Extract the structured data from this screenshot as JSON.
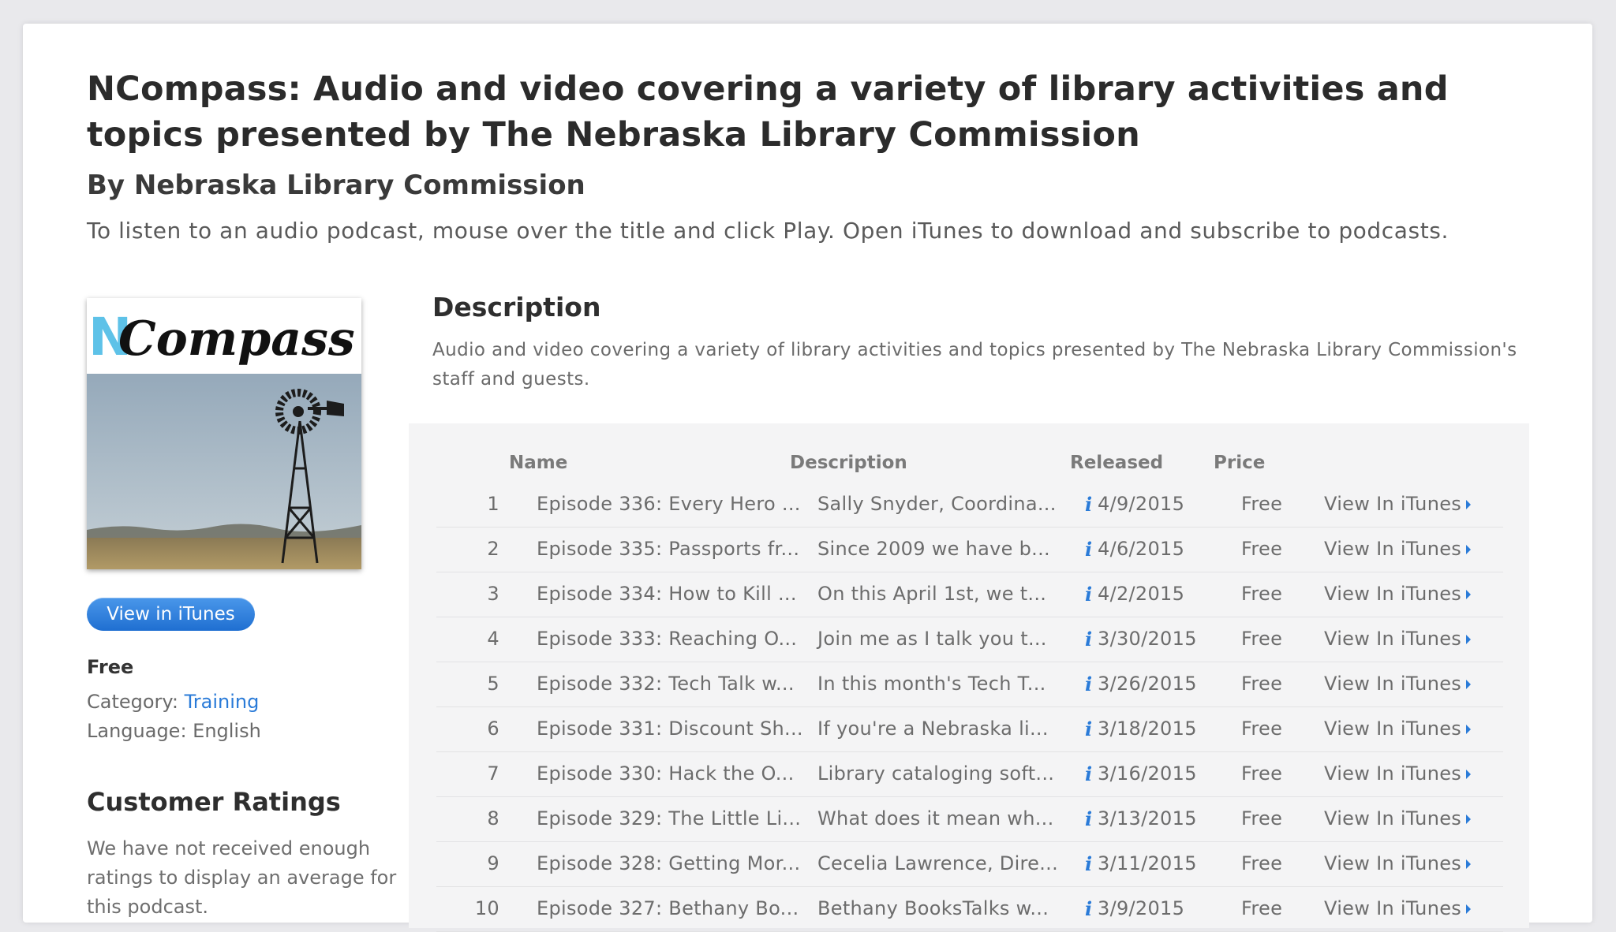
{
  "podcast": {
    "title": "NCompass: Audio and video covering a variety of library activities and topics presented by The Nebraska Library Commission",
    "byline": "By Nebraska Library Commission",
    "instructions": "To listen to an audio podcast, mouse over the title and click Play. Open iTunes to download and subscribe to podcasts.",
    "artwork_logo_text": "NCompass",
    "view_button_label": "View in iTunes",
    "price": "Free",
    "category_label": "Category: ",
    "category_value": "Training",
    "language_label": "Language: ",
    "language_value": "English"
  },
  "ratings": {
    "heading": "Customer Ratings",
    "text": "We have not received enough ratings to display an average for this podcast."
  },
  "description": {
    "heading": "Description",
    "text": "Audio and video covering a variety of library activities and topics presented by The Nebraska Library Commission's staff and guests."
  },
  "episodes": {
    "columns": {
      "name": "Name",
      "description": "Description",
      "released": "Released",
      "price": "Price"
    },
    "info_icon": "i",
    "link_label": "View In iTunes",
    "rows": [
      {
        "num": "1",
        "name": "Episode 336: Every Hero ...",
        "desc": "Sally Snyder, Coordina...",
        "date": "4/9/2015",
        "price": "Free"
      },
      {
        "num": "2",
        "name": "Episode 335: Passports fr...",
        "desc": "Since 2009 we have b...",
        "date": "4/6/2015",
        "price": "Free"
      },
      {
        "num": "3",
        "name": "Episode 334: How to Kill ...",
        "desc": "On this April 1st, we t...",
        "date": "4/2/2015",
        "price": "Free"
      },
      {
        "num": "4",
        "name": "Episode 333: Reaching O...",
        "desc": "Join me as I talk you t...",
        "date": "3/30/2015",
        "price": "Free"
      },
      {
        "num": "5",
        "name": "Episode 332: Tech Talk w...",
        "desc": "In this month's Tech T...",
        "date": "3/26/2015",
        "price": "Free"
      },
      {
        "num": "6",
        "name": "Episode 331: Discount Sh...",
        "desc": "If you're a Nebraska li...",
        "date": "3/18/2015",
        "price": "Free"
      },
      {
        "num": "7",
        "name": "Episode 330: Hack the O...",
        "desc": "Library cataloging soft...",
        "date": "3/16/2015",
        "price": "Free"
      },
      {
        "num": "8",
        "name": "Episode 329: The Little Li...",
        "desc": "What does it mean wh...",
        "date": "3/13/2015",
        "price": "Free"
      },
      {
        "num": "9",
        "name": "Episode 328: Getting Mor...",
        "desc": "Cecelia Lawrence, Dire...",
        "date": "3/11/2015",
        "price": "Free"
      },
      {
        "num": "10",
        "name": "Episode 327: Bethany Bo...",
        "desc": "Bethany BooksTalks w...",
        "date": "3/9/2015",
        "price": "Free"
      }
    ]
  }
}
